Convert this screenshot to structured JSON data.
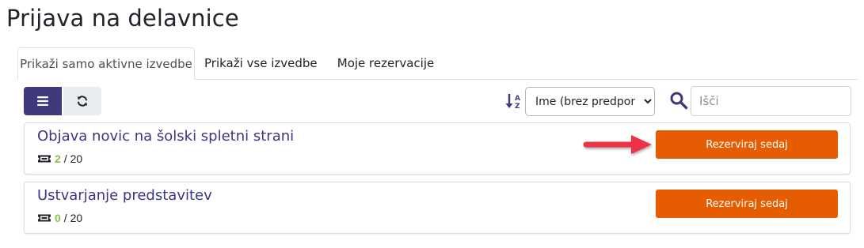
{
  "page": {
    "title": "Prijava na delavnice"
  },
  "tabs": [
    {
      "label": "Prikaži samo aktivne izvedbe",
      "active": true
    },
    {
      "label": "Prikaži vse izvedbe",
      "active": false
    },
    {
      "label": "Moje rezervacije",
      "active": false
    }
  ],
  "toolbar": {
    "list_icon": "list-icon",
    "refresh_icon": "refresh-icon",
    "sort_icon": "sort-alpha-down-icon",
    "sort": {
      "selected": "Ime (brez predpone)",
      "options": [
        "Ime (brez predpone)"
      ]
    },
    "search": {
      "placeholder": "Išči",
      "value": ""
    }
  },
  "workshops": [
    {
      "title": "Objava novic na šolski spletni strani",
      "seats_available": "2",
      "seats_total": "/ 20",
      "button_label": "Rezerviraj sedaj"
    },
    {
      "title": "Ustvarjanje predstavitev",
      "seats_available": "0",
      "seats_total": "/ 20",
      "button_label": "Rezerviraj sedaj"
    }
  ],
  "colors": {
    "primary": "#3f3a7c",
    "title": "#3b3589",
    "accent": "#e65c00",
    "available": "#8bc34a",
    "arrow": "#ee3344"
  }
}
